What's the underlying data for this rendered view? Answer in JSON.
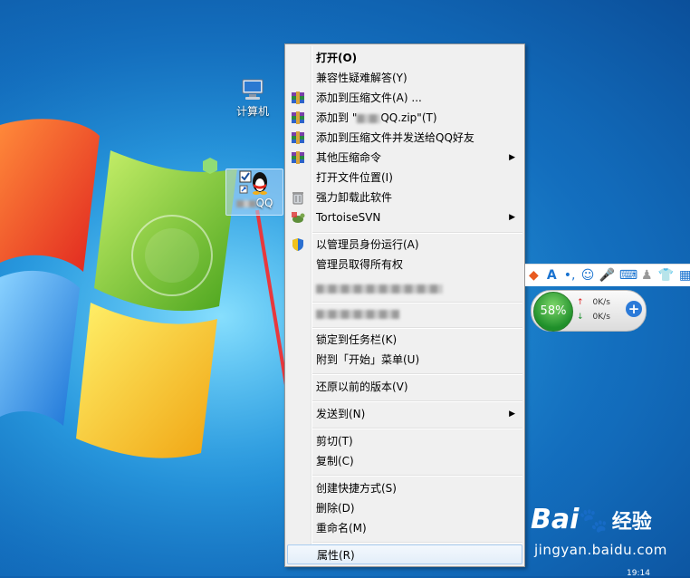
{
  "desktop": {
    "icons": [
      {
        "label": "计算机"
      },
      {
        "label": "QQ"
      }
    ]
  },
  "context_menu": {
    "items": {
      "open": "打开(O)",
      "compat": "兼容性疑难解答(Y)",
      "add_archive": "添加到压缩文件(A) ...",
      "add_zip_prefix": "添加到 \"",
      "add_zip_suffix": "QQ.zip\"(T)",
      "add_send_qq": "添加到压缩文件并发送给QQ好友",
      "other_cmd": "其他压缩命令",
      "open_location": "打开文件位置(I)",
      "uninstall": "强力卸载此软件",
      "svn": "TortoiseSVN",
      "run_admin": "以管理员身份运行(A)",
      "take_owner": "管理员取得所有权",
      "pin_taskbar": "锁定到任务栏(K)",
      "pin_start": "附到「开始」菜单(U)",
      "restore": "还原以前的版本(V)",
      "send_to": "发送到(N)",
      "cut": "剪切(T)",
      "copy": "复制(C)",
      "shortcut": "创建快捷方式(S)",
      "delete": "删除(D)",
      "rename": "重命名(M)",
      "properties": "属性(R)"
    }
  },
  "net_widget": {
    "percent": "58%",
    "up": "0K/s",
    "down": "0K/s"
  },
  "watermark": {
    "brand": "Bai",
    "brand2": "经验",
    "url": "jingyan.baidu.com"
  },
  "clock": "19:14",
  "colors": {
    "accent_arrow": "#e8383d",
    "menu_bg": "#f0f0f0",
    "highlight_border": "#a8cbef"
  }
}
